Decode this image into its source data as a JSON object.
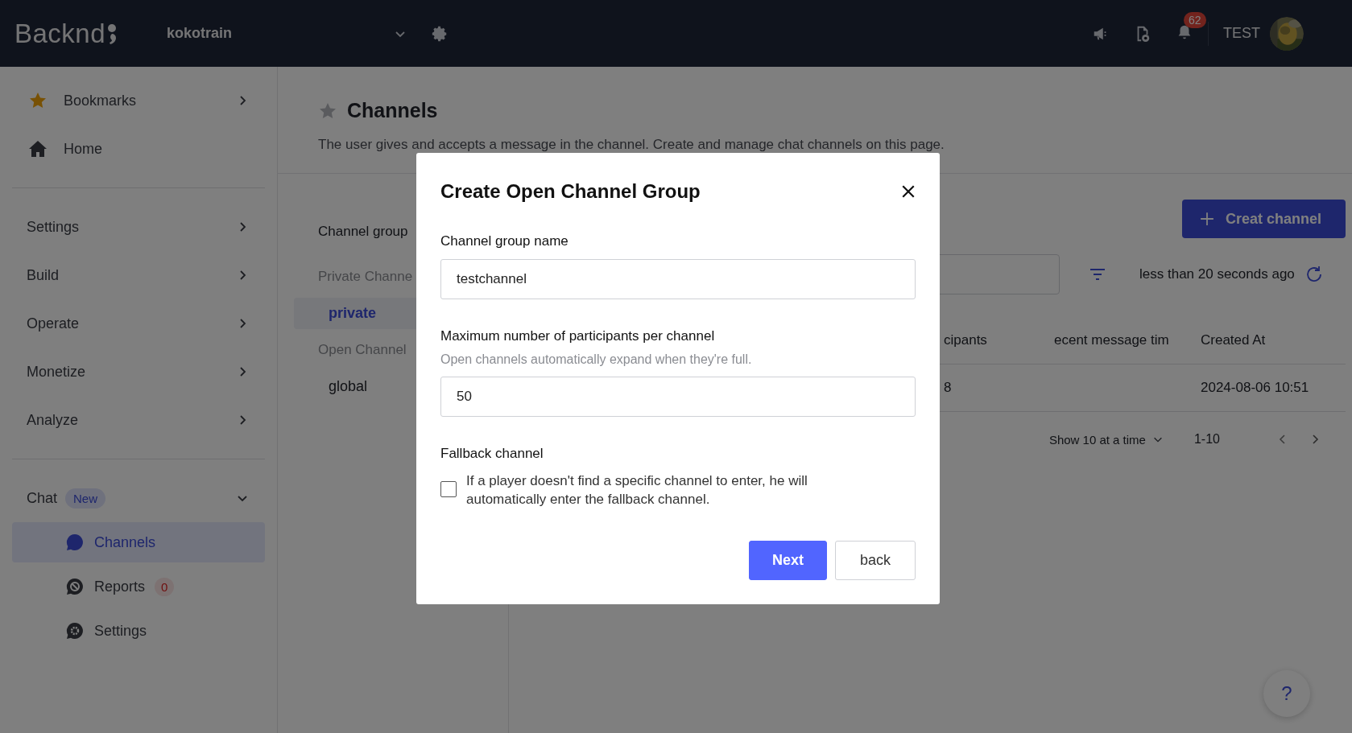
{
  "top_bar": {
    "logo": "Backnd",
    "project": "kokotrain",
    "notifications_badge": "62",
    "user": "TEST"
  },
  "sidebar": {
    "groups": [
      [
        {
          "label": "Bookmarks"
        },
        {
          "label": "Home"
        }
      ],
      [
        {
          "label": "Settings"
        },
        {
          "label": "Build"
        },
        {
          "label": "Operate"
        },
        {
          "label": "Monetize"
        },
        {
          "label": "Analyze"
        }
      ],
      [
        {
          "label": "Chat",
          "badge": "New",
          "expanded": true,
          "children": [
            {
              "label": "Channels",
              "selected": true
            },
            {
              "label": "Reports",
              "count": "0",
              "selected": false
            },
            {
              "label": "Settings",
              "selected": false
            }
          ]
        }
      ]
    ]
  },
  "page": {
    "title": "Channels",
    "bookmarked": false,
    "description": "The user gives and accepts a message in the channel. Create and manage chat channels on this page."
  },
  "channel_groups": {
    "heading": "Channel group",
    "sections": [
      {
        "title": "Private Channe",
        "items": [
          {
            "label": "private",
            "selected": true
          }
        ]
      },
      {
        "title": "Open Channel",
        "items": [
          {
            "label": "global",
            "selected": false
          }
        ]
      }
    ]
  },
  "toolbar": {
    "create_button": "Creat channel",
    "updated": "less than 20 seconds ago"
  },
  "table": {
    "columns": [
      "cipants",
      "ecent message tim",
      "Created At"
    ],
    "rows": [
      [
        "8",
        "",
        "2024-08-06 10:51"
      ]
    ]
  },
  "pagination": {
    "page_size": "Show 10 at a time",
    "range": "1-10"
  },
  "dialog": {
    "title": "Create Open Channel Group",
    "fields": [
      {
        "kind": "text",
        "label": "Channel group name",
        "value": "testchannel"
      },
      {
        "kind": "text",
        "label": "Maximum number of participants per channel",
        "hint": "Open channels automatically expand when they're full.",
        "value": "50"
      },
      {
        "kind": "checkbox",
        "label": "Fallback channel",
        "text": "If a player doesn't find a specific channel to enter, he will automatically enter the fallback channel.",
        "checked": false
      }
    ],
    "buttons": [
      {
        "label": "Next",
        "kind": "primary"
      },
      {
        "label": "back",
        "kind": "secondary"
      }
    ]
  },
  "help_button": "?"
}
